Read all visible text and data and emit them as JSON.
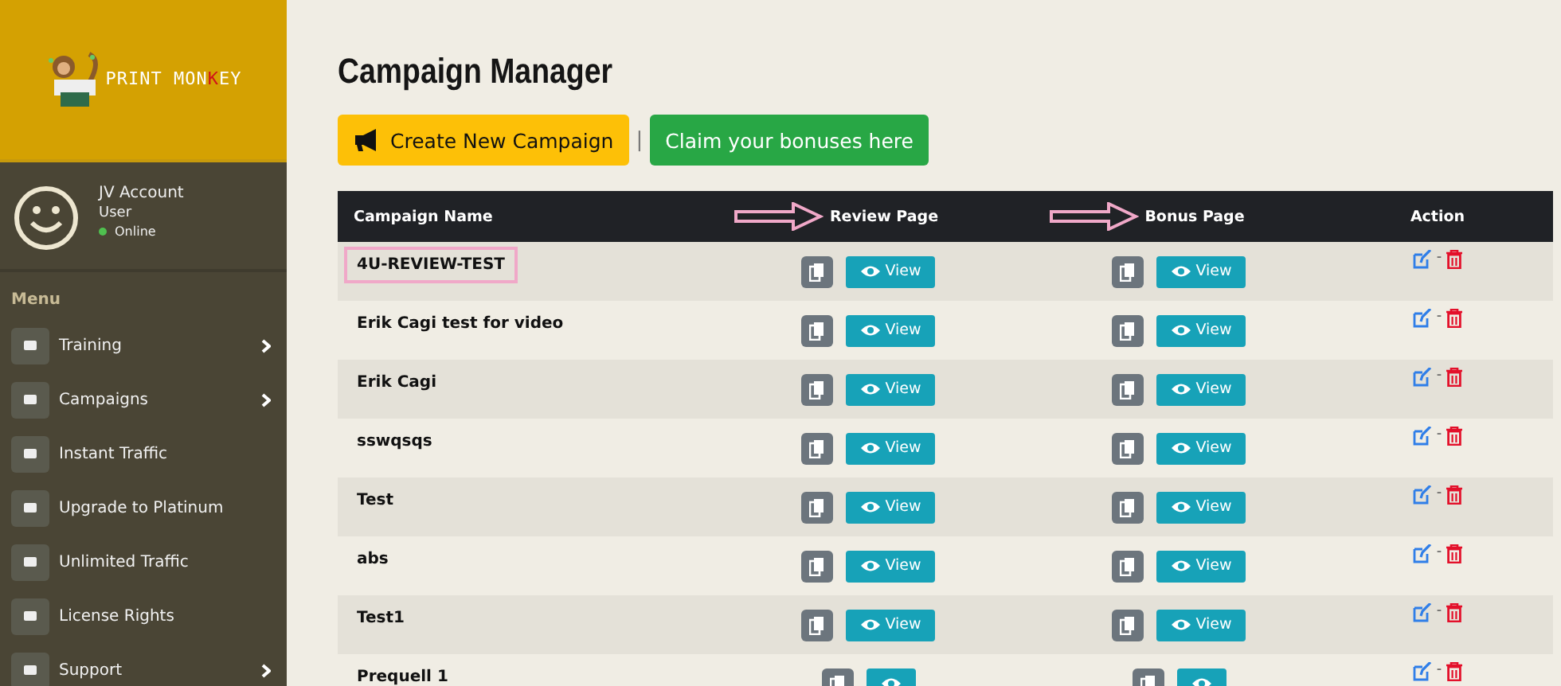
{
  "logo": {
    "segments": [
      {
        "text": "PRINT MON",
        "accent": false
      },
      {
        "text": "K",
        "accent": true
      },
      {
        "text": "EY",
        "accent": false
      }
    ]
  },
  "user": {
    "name": "JV Account",
    "role": "User",
    "status": "Online"
  },
  "menu": {
    "heading": "Menu",
    "items": [
      {
        "label": "Training",
        "has_submenu": true
      },
      {
        "label": "Campaigns",
        "has_submenu": true
      },
      {
        "label": "Instant Traffic",
        "has_submenu": false
      },
      {
        "label": "Upgrade to Platinum",
        "has_submenu": false
      },
      {
        "label": "Unlimited Traffic",
        "has_submenu": false
      },
      {
        "label": "License Rights",
        "has_submenu": false
      },
      {
        "label": "Support",
        "has_submenu": true
      }
    ]
  },
  "page_title": "Campaign Manager",
  "buttons": {
    "create": "Create New Campaign",
    "separator": "|",
    "claim": "Claim your bonuses here"
  },
  "table": {
    "columns": [
      {
        "label": "Campaign Name",
        "arrow": false
      },
      {
        "label": "Review Page",
        "arrow": true
      },
      {
        "label": "Bonus Page",
        "arrow": true
      },
      {
        "label": "Action",
        "arrow": false
      }
    ],
    "action_separator": "-",
    "rows": [
      {
        "name": "4U-REVIEW-TEST",
        "highlighted": true,
        "review_label": "View",
        "bonus_label": "View"
      },
      {
        "name": "Erik Cagi test for video",
        "highlighted": false,
        "review_label": "View",
        "bonus_label": "View"
      },
      {
        "name": "Erik Cagi",
        "highlighted": false,
        "review_label": "View",
        "bonus_label": "View"
      },
      {
        "name": "sswqsqs",
        "highlighted": false,
        "review_label": "View",
        "bonus_label": "View"
      },
      {
        "name": "Test",
        "highlighted": false,
        "review_label": "View",
        "bonus_label": "View"
      },
      {
        "name": "abs",
        "highlighted": false,
        "review_label": "View",
        "bonus_label": "View"
      },
      {
        "name": "Test1",
        "highlighted": false,
        "review_label": "View",
        "bonus_label": "View"
      },
      {
        "name": "Prequell 1",
        "highlighted": false
      }
    ]
  }
}
